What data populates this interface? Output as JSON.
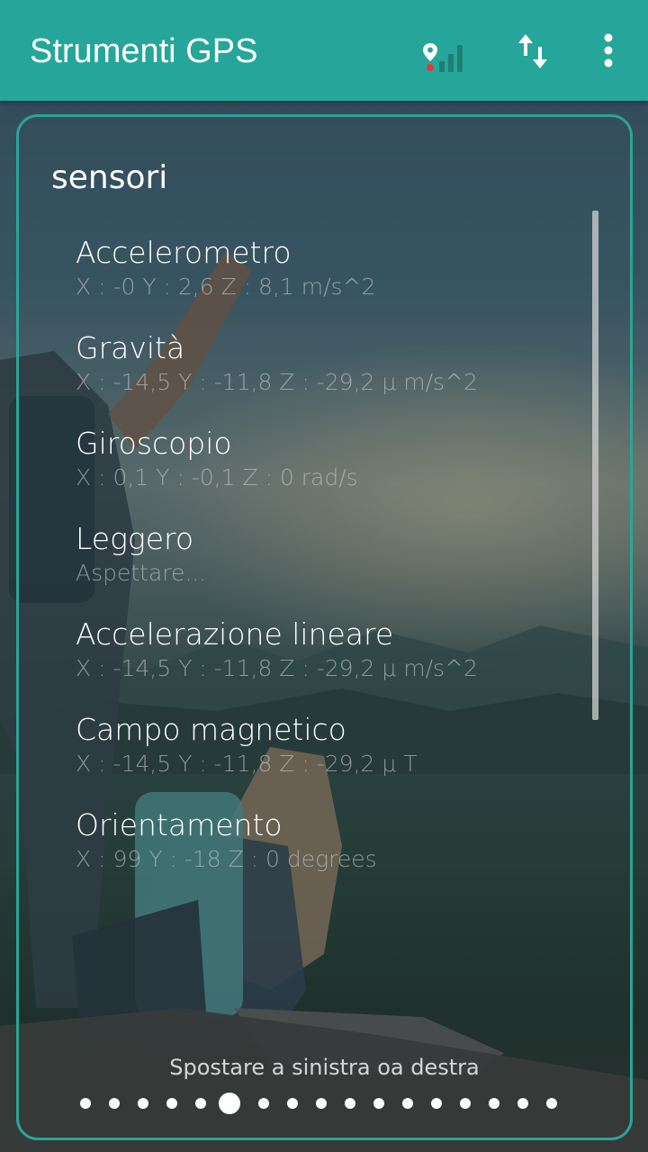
{
  "appbar": {
    "title": "Strumenti GPS",
    "icons": [
      "gps-signal-icon",
      "swap-vert-icon",
      "more-vert-icon"
    ],
    "color": "#26a69a"
  },
  "card": {
    "title": "sensori",
    "border_color": "#2aa596",
    "sensors": [
      {
        "name": "Accelerometro",
        "value": "X : -0  Y : 2,6  Z : 8,1 m/s^2"
      },
      {
        "name": "Gravità",
        "value": "X : -14,5  Y : -11,8  Z : -29,2 μ m/s^2"
      },
      {
        "name": "Giroscopio",
        "value": "X : 0,1  Y : -0,1  Z : 0 rad/s"
      },
      {
        "name": "Leggero",
        "value": "Aspettare..."
      },
      {
        "name": "Accelerazione lineare",
        "value": "X : -14,5  Y : -11,8  Z : -29,2 μ m/s^2"
      },
      {
        "name": "Campo magnetico",
        "value": "X : -14,5  Y : -11,8  Z : -29,2 μ T"
      },
      {
        "name": "Orientamento",
        "value": "X : 99  Y : -18  Z : 0 degrees"
      }
    ],
    "hint": "Spostare a sinistra oa destra"
  },
  "pager": {
    "count": 17,
    "active_index": 5
  }
}
